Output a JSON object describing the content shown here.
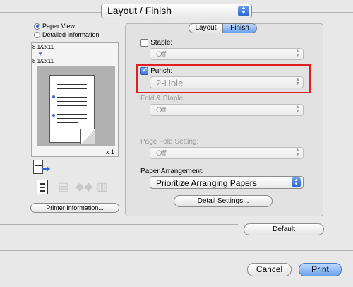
{
  "header": {
    "popup_value": "Layout / Finish"
  },
  "view_options": {
    "paper_view": "Paper View",
    "detailed_information": "Detailed Information",
    "selected": "paper_view"
  },
  "preview": {
    "paper_size_1": "8 1/2x11",
    "paper_size_2": "8 1/2x11",
    "copies": "x 1",
    "printer_information_label": "Printer Information..."
  },
  "tabs": [
    {
      "label": "Layout",
      "selected": false
    },
    {
      "label": "Finish",
      "selected": true
    }
  ],
  "staple": {
    "label": "Staple:",
    "checked": false,
    "value": "Off"
  },
  "punch": {
    "label": "Punch:",
    "checked": true,
    "value": "2-Hole"
  },
  "fold_staple": {
    "label": "Fold & Staple:",
    "value": "Off"
  },
  "page_fold": {
    "label": "Page Fold Setting:",
    "value": "Off"
  },
  "paper_arrangement": {
    "label": "Paper Arrangement:",
    "value": "Prioritize Arranging Papers"
  },
  "buttons": {
    "detail_settings": "Detail Settings...",
    "default": "Default",
    "cancel": "Cancel",
    "print": "Print"
  },
  "colors": {
    "accent": "#2a64cf",
    "highlight": "#e02020"
  }
}
